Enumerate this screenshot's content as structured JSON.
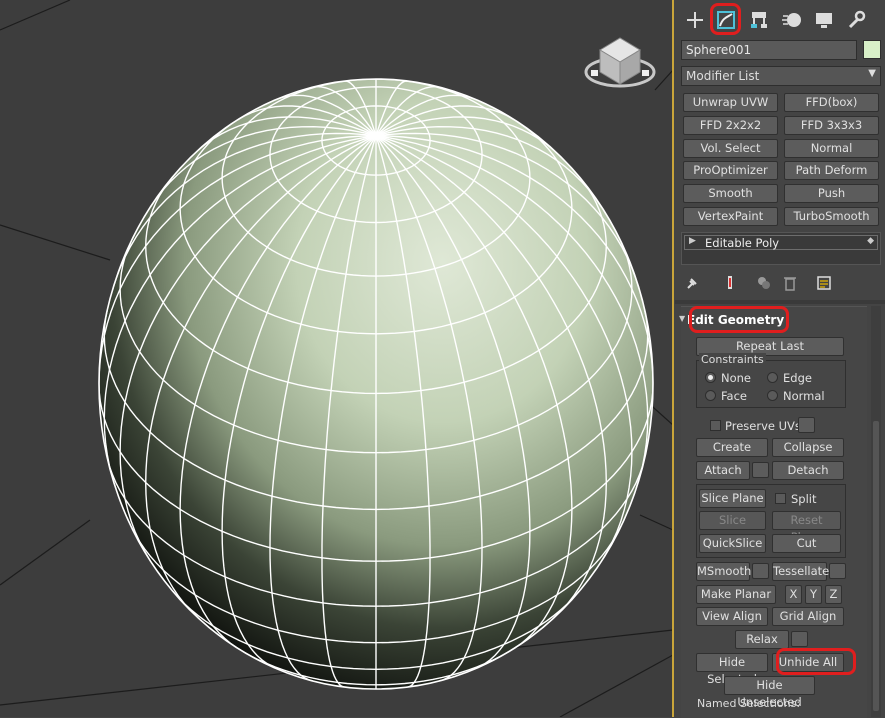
{
  "command_panel": {
    "tabs": [
      {
        "icon": "plus-icon",
        "name": "create"
      },
      {
        "icon": "modify-icon",
        "name": "modify",
        "active": true
      },
      {
        "icon": "hierarchy-icon",
        "name": "hierarchy"
      },
      {
        "icon": "motion-icon",
        "name": "motion"
      },
      {
        "icon": "display-icon",
        "name": "display"
      },
      {
        "icon": "wrench-icon",
        "name": "utilities"
      }
    ],
    "object_name": "Sphere001",
    "object_color": "#d8f0c8",
    "modifier_list_label": "Modifier List",
    "modifier_buttons": [
      [
        "Unwrap UVW",
        "FFD(box)"
      ],
      [
        "FFD 2x2x2",
        "FFD 3x3x3"
      ],
      [
        "Vol. Select",
        "Normal"
      ],
      [
        "ProOptimizer",
        "Path Deform"
      ],
      [
        "Smooth",
        "Push"
      ],
      [
        "VertexPaint",
        "TurboSmooth"
      ]
    ],
    "stack_item": "Editable Poly"
  },
  "edit_geometry": {
    "title": "Edit Geometry",
    "repeat_last": "Repeat Last",
    "constraints_title": "Constraints",
    "constraints": {
      "none": "None",
      "edge": "Edge",
      "face": "Face",
      "normal": "Normal"
    },
    "preserve_uvs": "Preserve UVs",
    "create": "Create",
    "collapse": "Collapse",
    "attach": "Attach",
    "detach": "Detach",
    "slice_plane": "Slice Plane",
    "split": "Split",
    "slice": "Slice",
    "reset_plane": "Reset Plane",
    "quickslice": "QuickSlice",
    "cut": "Cut",
    "msmooth": "MSmooth",
    "tessellate": "Tessellate",
    "make_planar": "Make Planar",
    "x": "X",
    "y": "Y",
    "z": "Z",
    "view_align": "View Align",
    "grid_align": "Grid Align",
    "relax": "Relax",
    "hide_selected": "Hide Selected",
    "unhide_all": "Unhide All",
    "hide_unselected": "Hide Unselected",
    "named_selections": "Named Selections:"
  },
  "colors": {
    "highlight": "#e01e1e",
    "viewport_border": "#c9a53a",
    "sphere": "#c8d8bc"
  }
}
